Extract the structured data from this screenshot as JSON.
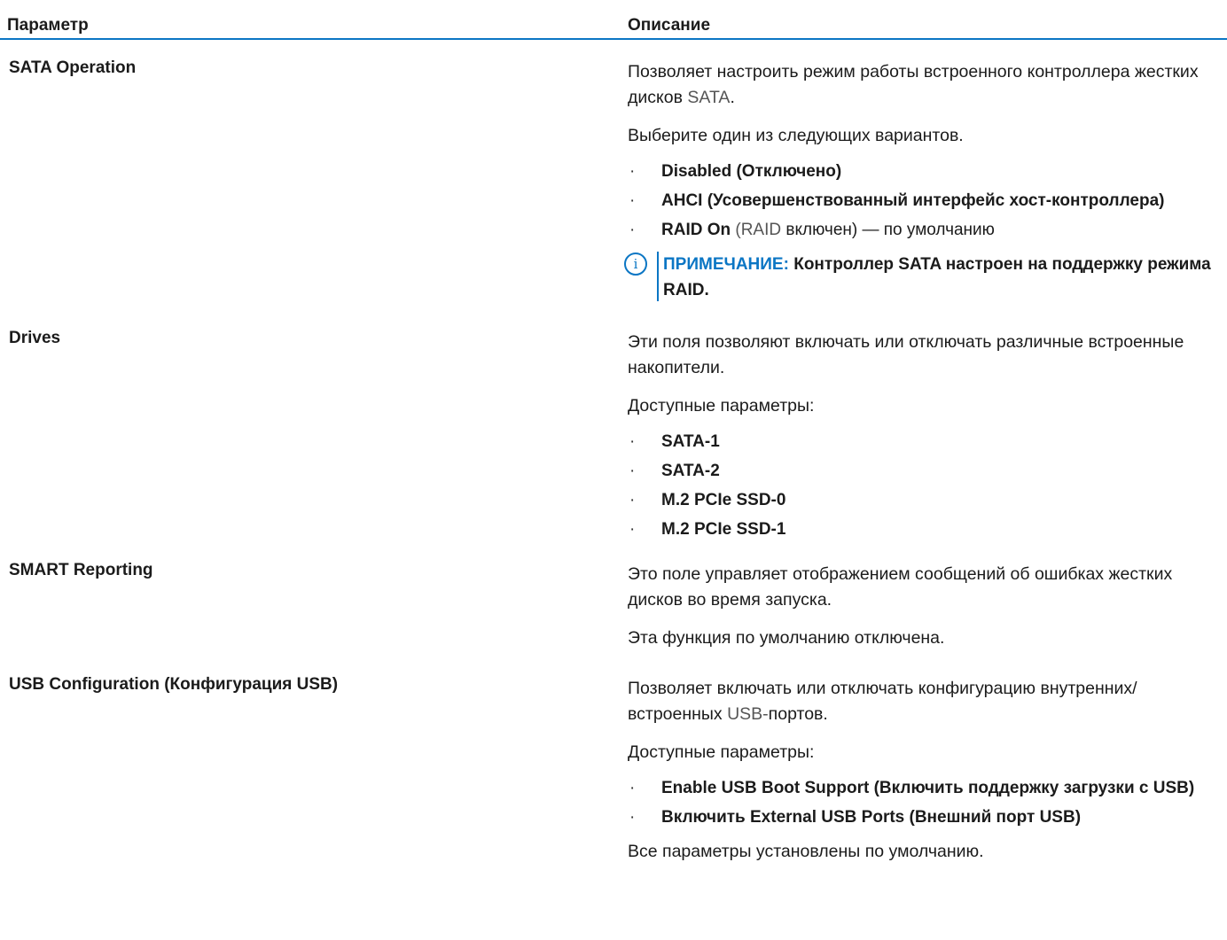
{
  "header": {
    "param": "Параметр",
    "desc": "Описание"
  },
  "rows": [
    {
      "name": "SATA Operation",
      "p1_a": "Позволяет настроить режим работы встроенного контроллера жестких дисков ",
      "p1_b": "SATA",
      "p1_c": ".",
      "p2": "Выберите один из следующих вариантов.",
      "options": [
        {
          "bold": "Disabled (Отключено)",
          "rest": ""
        },
        {
          "bold": "AHCI (Усовершенствованный интерфейс хост-контроллера)",
          "rest": ""
        },
        {
          "bold": "RAID On",
          "rest_light": " (RAID",
          "rest": " включен) — по умолчанию"
        }
      ],
      "note_label": "ПРИМЕЧАНИЕ:",
      "note_text": " Контроллер SATA настроен на поддержку режима RAID."
    },
    {
      "name": "Drives",
      "p1": "Эти поля позволяют включать или отключать различные встроенные накопители.",
      "p2": "Доступные параметры:",
      "options": [
        "SATA-1",
        "SATA-2",
        "M.2 PCIe SSD-0",
        "M.2 PCIe SSD-1"
      ]
    },
    {
      "name": "SMART Reporting",
      "p1": "Это поле управляет отображением сообщений об ошибках жестких дисков во время запуска.",
      "p2": "Эта функция по умолчанию отключена."
    },
    {
      "name": "USB Configuration (Конфигурация USB)",
      "p1_a": "Позволяет включать или отключать конфигурацию внутренних/встроенных ",
      "p1_b": "USB-",
      "p1_c": "портов.",
      "p2": "Доступные параметры:",
      "options": [
        "Enable USB Boot Support (Включить поддержку загрузки с USB)",
        "Включить External USB Ports (Внешний порт USB)"
      ],
      "p3": "Все параметры установлены по умолчанию."
    }
  ],
  "bullet": "·",
  "note_icon": "i",
  "colors": {
    "accent": "#0b76c4",
    "text": "#1b1b1b"
  }
}
